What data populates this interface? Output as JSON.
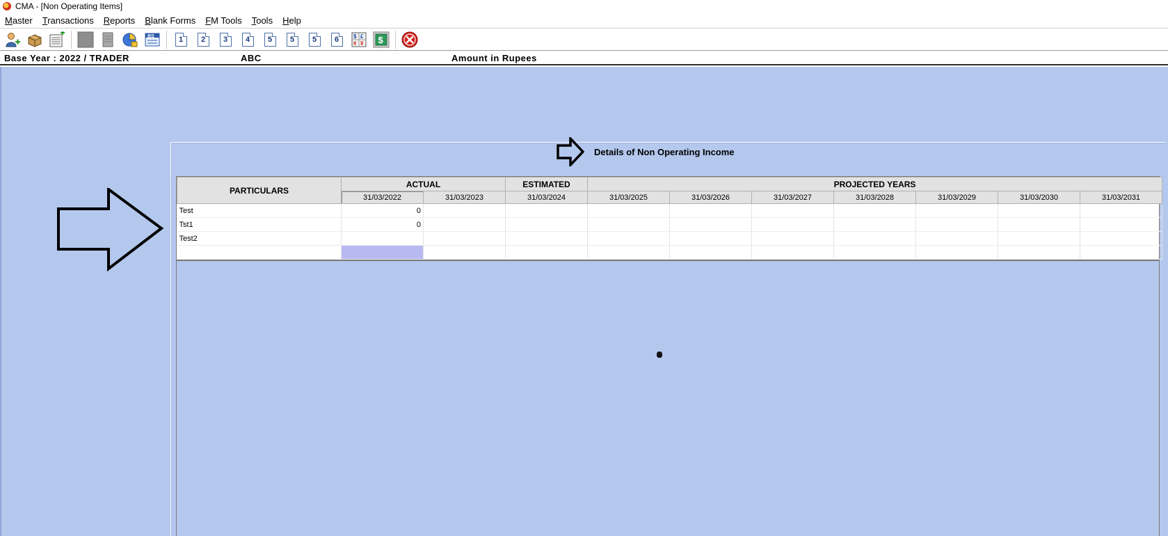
{
  "window": {
    "title": "CMA - [Non Operating Items]"
  },
  "menu": [
    {
      "pre": "",
      "mn": "M",
      "post": "aster"
    },
    {
      "pre": "",
      "mn": "T",
      "post": "ransactions"
    },
    {
      "pre": "",
      "mn": "R",
      "post": "eports"
    },
    {
      "pre": "",
      "mn": "B",
      "post": "lank Forms"
    },
    {
      "pre": "",
      "mn": "F",
      "post": "M Tools"
    },
    {
      "pre": "",
      "mn": "T",
      "post": "ools"
    },
    {
      "pre": "",
      "mn": "H",
      "post": "elp"
    }
  ],
  "toolbar": {
    "icons": [
      "add-user-icon",
      "boxes-icon",
      "add-sheet-icon",
      "grey-square-icon",
      "document-icon",
      "chart-icon",
      "bs-icon"
    ],
    "numbers": [
      "1",
      "2",
      "3",
      "4",
      "5",
      "5",
      "5",
      "6"
    ],
    "extra": [
      "formula-icon",
      "dollar-icon",
      "close-icon"
    ]
  },
  "info": {
    "base_year": "Base Year : 2022 / TRADER",
    "company": "ABC",
    "amount": "Amount in Rupees"
  },
  "form": {
    "title": "Details of Non Operating Income"
  },
  "grid": {
    "particulars_header": "PARTICULARS",
    "actual_header": "ACTUAL",
    "estimated_header": "ESTIMATED",
    "projected_header": "PROJECTED YEARS",
    "dates": [
      "31/03/2022",
      "31/03/2023",
      "31/03/2024",
      "31/03/2025",
      "31/03/2026",
      "31/03/2027",
      "31/03/2028",
      "31/03/2029",
      "31/03/2030",
      "31/03/2031"
    ],
    "rows": [
      {
        "label": "Test",
        "values": [
          "0",
          "",
          "",
          "",
          "",
          "",
          "",
          "",
          "",
          ""
        ]
      },
      {
        "label": "Tst1",
        "values": [
          "0",
          "",
          "",
          "",
          "",
          "",
          "",
          "",
          "",
          ""
        ]
      },
      {
        "label": "Test2",
        "values": [
          "",
          "",
          "",
          "",
          "",
          "",
          "",
          "",
          "",
          ""
        ]
      },
      {
        "label": "",
        "values": [
          "",
          "",
          "",
          "",
          "",
          "",
          "",
          "",
          "",
          ""
        ]
      }
    ],
    "active_cell": {
      "row": 3,
      "col": 0
    }
  },
  "colors": {
    "workspace": "#b4c8ee",
    "active_cell": "#b9b9f2"
  }
}
